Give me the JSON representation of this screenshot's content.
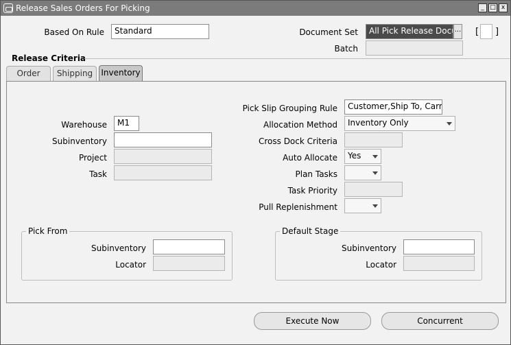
{
  "window": {
    "title": "Release Sales Orders For Picking",
    "controls": [
      "_",
      "□",
      "x"
    ]
  },
  "header": {
    "based_on_rule_label": "Based On Rule",
    "based_on_rule_value": "Standard",
    "document_set_label": "Document Set",
    "document_set_value": "All Pick Release Documents",
    "batch_label": "Batch",
    "batch_value": "",
    "bracket_open": "[",
    "bracket_close": "]",
    "lov_button": "..."
  },
  "release_criteria": {
    "title": "Release Criteria",
    "tabs": [
      {
        "label": "Order",
        "active": false
      },
      {
        "label": "Shipping",
        "active": false
      },
      {
        "label": "Inventory",
        "active": true
      }
    ]
  },
  "inventory": {
    "pick_slip_grouping_rule": {
      "label": "Pick Slip Grouping Rule",
      "value": "Customer,Ship To, Carrier"
    },
    "warehouse": {
      "label": "Warehouse",
      "value": "M1"
    },
    "allocation_method": {
      "label": "Allocation Method",
      "value": "Inventory Only"
    },
    "subinventory": {
      "label": "Subinventory",
      "value": ""
    },
    "cross_dock_criteria": {
      "label": "Cross Dock Criteria",
      "value": ""
    },
    "project": {
      "label": "Project",
      "value": ""
    },
    "auto_allocate": {
      "label": "Auto Allocate",
      "value": "Yes"
    },
    "task": {
      "label": "Task",
      "value": ""
    },
    "plan_tasks": {
      "label": "Plan Tasks",
      "value": ""
    },
    "task_priority": {
      "label": "Task Priority",
      "value": ""
    },
    "pull_replenishment": {
      "label": "Pull Replenishment",
      "value": ""
    }
  },
  "pick_from": {
    "title": "Pick From",
    "subinventory_label": "Subinventory",
    "subinventory_value": "",
    "locator_label": "Locator",
    "locator_value": ""
  },
  "default_stage": {
    "title": "Default Stage",
    "subinventory_label": "Subinventory",
    "subinventory_value": "",
    "locator_label": "Locator",
    "locator_value": ""
  },
  "buttons": {
    "execute_now": "Execute Now",
    "concurrent": "Concurrent"
  }
}
